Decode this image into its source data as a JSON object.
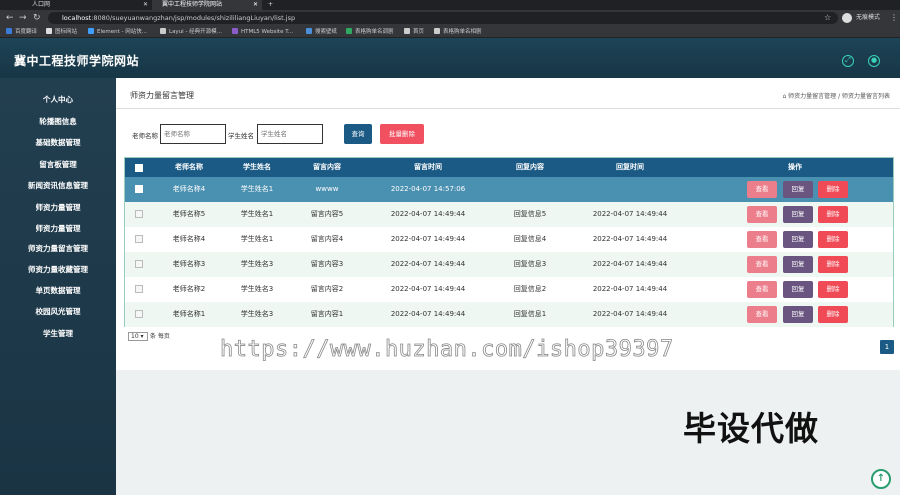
{
  "browser": {
    "tabs": [
      {
        "label": "人口网"
      },
      {
        "label": "翼中工程技师学院网站"
      }
    ],
    "new_tab": "+",
    "url_host": "localhost",
    "url_rest": ":8080/sueyuanwangzhan/jsp/modules/shizililiangLiuyan/list.jsp",
    "profile_label": "无痕模式",
    "bookmarks": [
      "百度翻译",
      "图标网站",
      "Element - 网站快...",
      "Layui - 经典开源模...",
      "HTML5 Website T...",
      "搜索壁纸",
      "表格购单名调剧",
      "首页",
      "表格购单名相剧"
    ]
  },
  "app": {
    "title": "冀中工程技师学院网站"
  },
  "colors": {
    "header_bg": "#1b3a4b",
    "table_header": "#1a5a85",
    "highlight_row": "#4a90b0",
    "view_btn": "#ec7d8a",
    "reply_btn": "#6a5580",
    "delete_btn": "#f04a56",
    "accent_icon": "#3ad1b7"
  },
  "sidebar": {
    "items": [
      "个人中心",
      "轮播图信息",
      "基础数据管理",
      "留言板管理",
      "新闻资讯信息管理",
      "师资力量管理",
      "师资力量管理",
      "师资力量留言管理",
      "师资力量收藏管理",
      "单页数据管理",
      "校园风光管理",
      "学生管理"
    ]
  },
  "page": {
    "title": "师资力量留言管理",
    "breadcrumb": "师资力量留言管理 / 师资力量留言列表"
  },
  "search": {
    "teacher_label": "老师名称",
    "teacher_placeholder": "老师名称",
    "student_label": "学生姓名",
    "student_placeholder": "学生姓名",
    "search_button": "查询",
    "batch_delete_button": "批量删除"
  },
  "table": {
    "headers": [
      "老师名称",
      "学生姓名",
      "留言内容",
      "留言时间",
      "回复内容",
      "回复时间",
      "操作"
    ],
    "rows": [
      {
        "teacher": "老师名称4",
        "student": "学生姓名1",
        "content": "wwww",
        "time": "2022-04-07 14:57:06",
        "reply": "",
        "reply_time": ""
      },
      {
        "teacher": "老师名称5",
        "student": "学生姓名1",
        "content": "留言内容5",
        "time": "2022-04-07 14:49:44",
        "reply": "回复信息5",
        "reply_time": "2022-04-07 14:49:44"
      },
      {
        "teacher": "老师名称4",
        "student": "学生姓名1",
        "content": "留言内容4",
        "time": "2022-04-07 14:49:44",
        "reply": "回复信息4",
        "reply_time": "2022-04-07 14:49:44"
      },
      {
        "teacher": "老师名称3",
        "student": "学生姓名3",
        "content": "留言内容3",
        "time": "2022-04-07 14:49:44",
        "reply": "回复信息3",
        "reply_time": "2022-04-07 14:49:44"
      },
      {
        "teacher": "老师名称2",
        "student": "学生姓名3",
        "content": "留言内容2",
        "time": "2022-04-07 14:49:44",
        "reply": "回复信息2",
        "reply_time": "2022-04-07 14:49:44"
      },
      {
        "teacher": "老师名称1",
        "student": "学生姓名3",
        "content": "留言内容1",
        "time": "2022-04-07 14:49:44",
        "reply": "回复信息1",
        "reply_time": "2022-04-07 14:49:44"
      }
    ],
    "actions": {
      "view": "查看",
      "reply": "回复",
      "delete": "删除"
    }
  },
  "pagination": {
    "page_size": "10",
    "per_page_label": "条 每页",
    "current_page": "1"
  },
  "overlay": {
    "watermark": "https://www.huzhan.com/ishop39397",
    "promo": "毕设代做"
  }
}
